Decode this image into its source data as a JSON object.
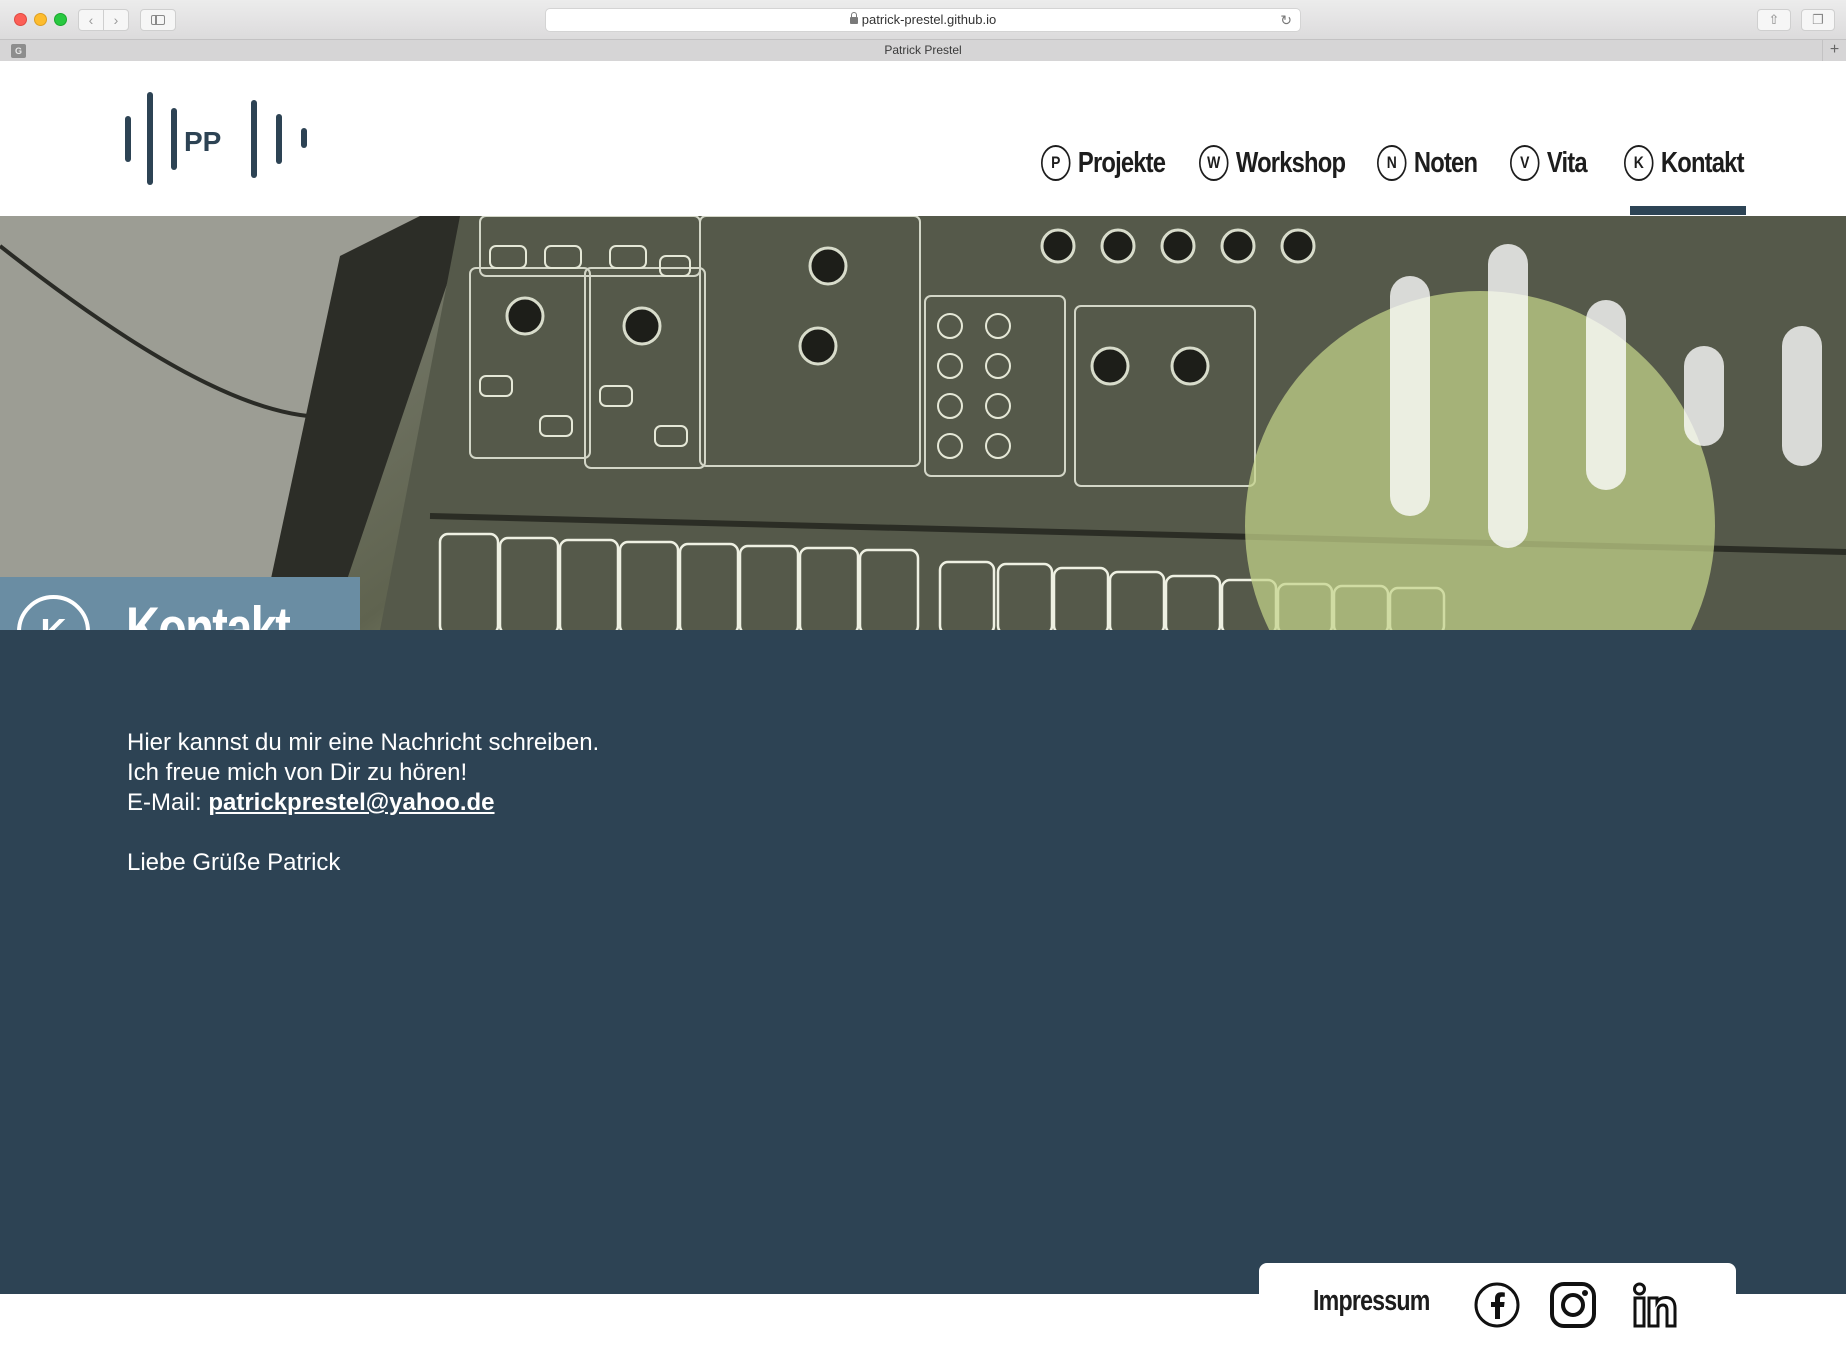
{
  "browser": {
    "url": "patrick-prestel.github.io",
    "tab_title": "Patrick Prestel",
    "favicon_letter": "G",
    "icons": [
      "back-icon",
      "forward-icon",
      "sidebar-icon",
      "lock-icon",
      "reload-icon",
      "share-icon",
      "tabs-icon",
      "new-tab-icon"
    ]
  },
  "site": {
    "logo_letters": "PP",
    "nav": [
      {
        "badge": "P",
        "label": "Projekte"
      },
      {
        "badge": "W",
        "label": "Workshop"
      },
      {
        "badge": "N",
        "label": "Noten"
      },
      {
        "badge": "V",
        "label": "Vita"
      },
      {
        "badge": "K",
        "label": "Kontakt",
        "active": true
      }
    ],
    "colors": {
      "primary": "#2d4354",
      "title_box": "#6a8da3",
      "accent": "#c5d48a"
    }
  },
  "page": {
    "title_badge": "K",
    "title": "Kontakt",
    "line1": "Hier kannst du mir eine Nachricht schreiben.",
    "line2": "Ich freue mich von Dir zu hören!",
    "email_label": "E-Mail: ",
    "email": "patrickprestel@yahoo.de",
    "closing": "Liebe Grüße Patrick"
  },
  "footer": {
    "impressum": "Impressum",
    "social": [
      "facebook-icon",
      "instagram-icon",
      "linkedin-icon"
    ]
  }
}
